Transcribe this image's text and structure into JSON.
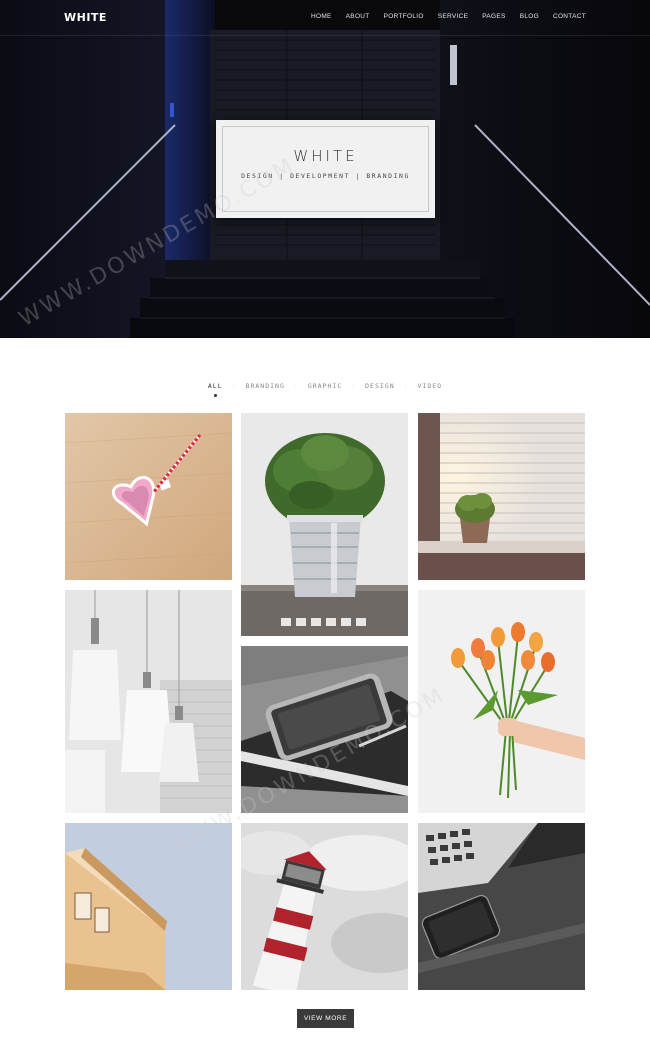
{
  "nav": {
    "logo": "WHITE",
    "items": [
      "HOME",
      "ABOUT",
      "PORTFOLIO",
      "SERVICE",
      "PAGES",
      "BLOG",
      "CONTACT"
    ]
  },
  "hero": {
    "title": "WHITE",
    "subtitle": "DESIGN | DEVELOPMENT | BRANDING"
  },
  "portfolio": {
    "filters": [
      "ALL",
      "BRANDING",
      "GRAPHIC",
      "DESIGN",
      "VIDEO"
    ],
    "active_filter": "ALL",
    "items": [
      {
        "name": "heart-cup-photo"
      },
      {
        "name": "potted-plant-photo"
      },
      {
        "name": "window-plant-photo"
      },
      {
        "name": "pendant-lamps-photo"
      },
      {
        "name": "phone-notebook-photo"
      },
      {
        "name": "tulips-bouquet-photo"
      },
      {
        "name": "building-corner-photo"
      },
      {
        "name": "lighthouse-photo"
      },
      {
        "name": "laptop-phone-photo"
      }
    ]
  },
  "view_more_label": "VIEW MORE",
  "watermark": "WWW.DOWNDEMO.COM",
  "colors": {
    "hero_bg": "#0a0a12",
    "accent_dark": "#3a3a3a",
    "card_bg": "#f1f1f1"
  }
}
